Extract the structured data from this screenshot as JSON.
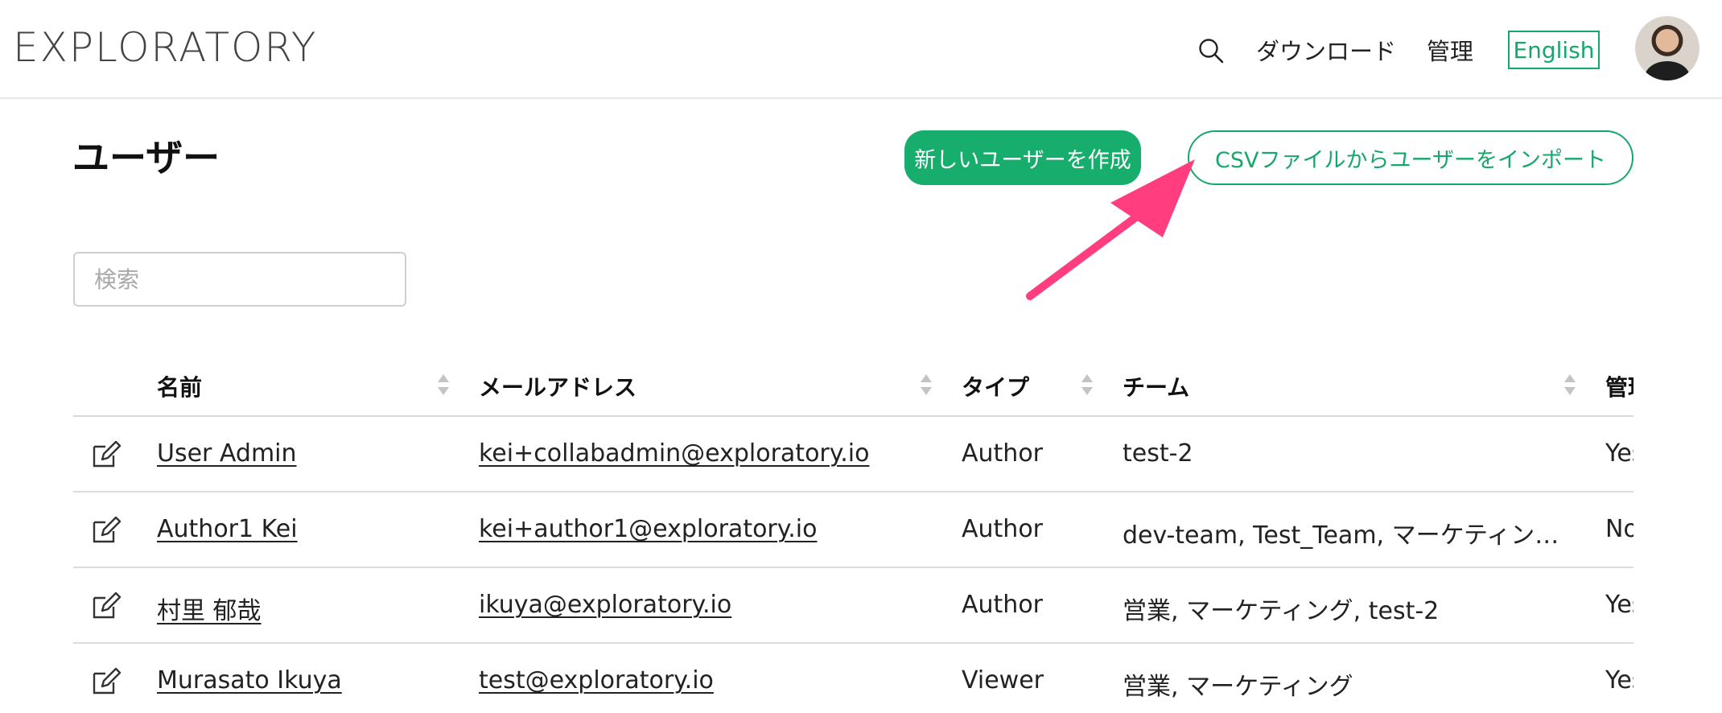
{
  "header": {
    "logo": "EXPLORATORY",
    "nav": {
      "download": "ダウンロード",
      "admin": "管理"
    },
    "language_button": "English",
    "icons": {
      "search": "search-icon",
      "avatar": "user-avatar"
    }
  },
  "page": {
    "title": "ユーザー",
    "create_button": "新しいユーザーを作成",
    "import_button": "CSVファイルからユーザーをインポート",
    "search_placeholder": "検索"
  },
  "table": {
    "columns": [
      "名前",
      "メールアドレス",
      "タイプ",
      "チーム",
      "管理"
    ],
    "rows": [
      {
        "name": "User Admin",
        "email": "kei+collabadmin@exploratory.io",
        "type": "Author",
        "team": "test-2",
        "admin": "Yes"
      },
      {
        "name": "Author1 Kei",
        "email": "kei+author1@exploratory.io",
        "type": "Author",
        "team": "dev-team, Test_Team, マーケティング, 営業",
        "admin": "No"
      },
      {
        "name": "村里 郁哉",
        "email": "ikuya@exploratory.io",
        "type": "Author",
        "team": "営業, マーケティング, test-2",
        "admin": "Yes"
      },
      {
        "name": "Murasato Ikuya",
        "email": "test@exploratory.io",
        "type": "Viewer",
        "team": "営業, マーケティング",
        "admin": "Yes"
      }
    ]
  },
  "colors": {
    "accent": "#17ad6c",
    "annotation_arrow": "#ff3d7f"
  }
}
